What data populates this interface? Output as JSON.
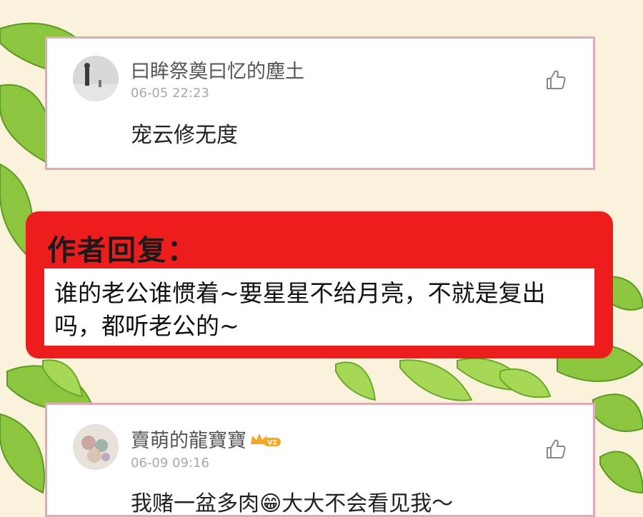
{
  "comments": [
    {
      "username": "曰眸祭奠曰忆的塵土",
      "timestamp": "06-05 22:23",
      "text": "宠云修无度"
    },
    {
      "username": "賣萌的龍寶寶",
      "badge": "V2",
      "timestamp": "06-09 09:16",
      "text": "我赌一盆多肉😁大大不会看见我～"
    }
  ],
  "author_reply": {
    "title": "作者回复：",
    "text": "谁的老公谁惯着~要星星不给月亮，不就是复出吗，都听老公的~"
  },
  "icons": {
    "like": "thumbs-up-icon",
    "badge": "crown-icon"
  },
  "colors": {
    "reply_background": "#ee1d1d",
    "card_border": "#e3a9b6",
    "page_background": "#fbf2dc",
    "badge": "#f5a623"
  }
}
